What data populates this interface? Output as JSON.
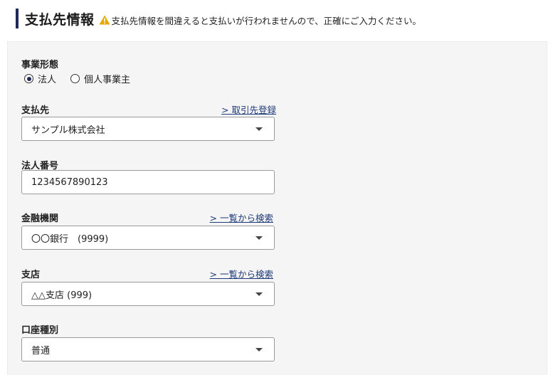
{
  "header": {
    "title": "支払先情報",
    "warning_text": "支払先情報を間違えると支払いが行われませんので、正確にご入力ください。",
    "warning_color": "#e6a700"
  },
  "form": {
    "business_type": {
      "label": "事業形態",
      "options": [
        {
          "label": "法人",
          "checked": true
        },
        {
          "label": "個人事業主",
          "checked": false
        }
      ]
    },
    "payee": {
      "label": "支払先",
      "link": "> 取引先登録",
      "value": "サンプル株式会社"
    },
    "corporate_number": {
      "label": "法人番号",
      "value": "1234567890123"
    },
    "bank": {
      "label": "金融機関",
      "link": "> 一覧から検索",
      "value": "〇〇銀行　(9999)"
    },
    "branch": {
      "label": "支店",
      "link": "> 一覧から検索",
      "value": "△△支店 (999)"
    },
    "account_type": {
      "label": "口座種別",
      "value": "普通"
    }
  },
  "colors": {
    "accent": "#1f2a5a",
    "link": "#1f3a7a",
    "panel_bg": "#f5f5f5"
  }
}
